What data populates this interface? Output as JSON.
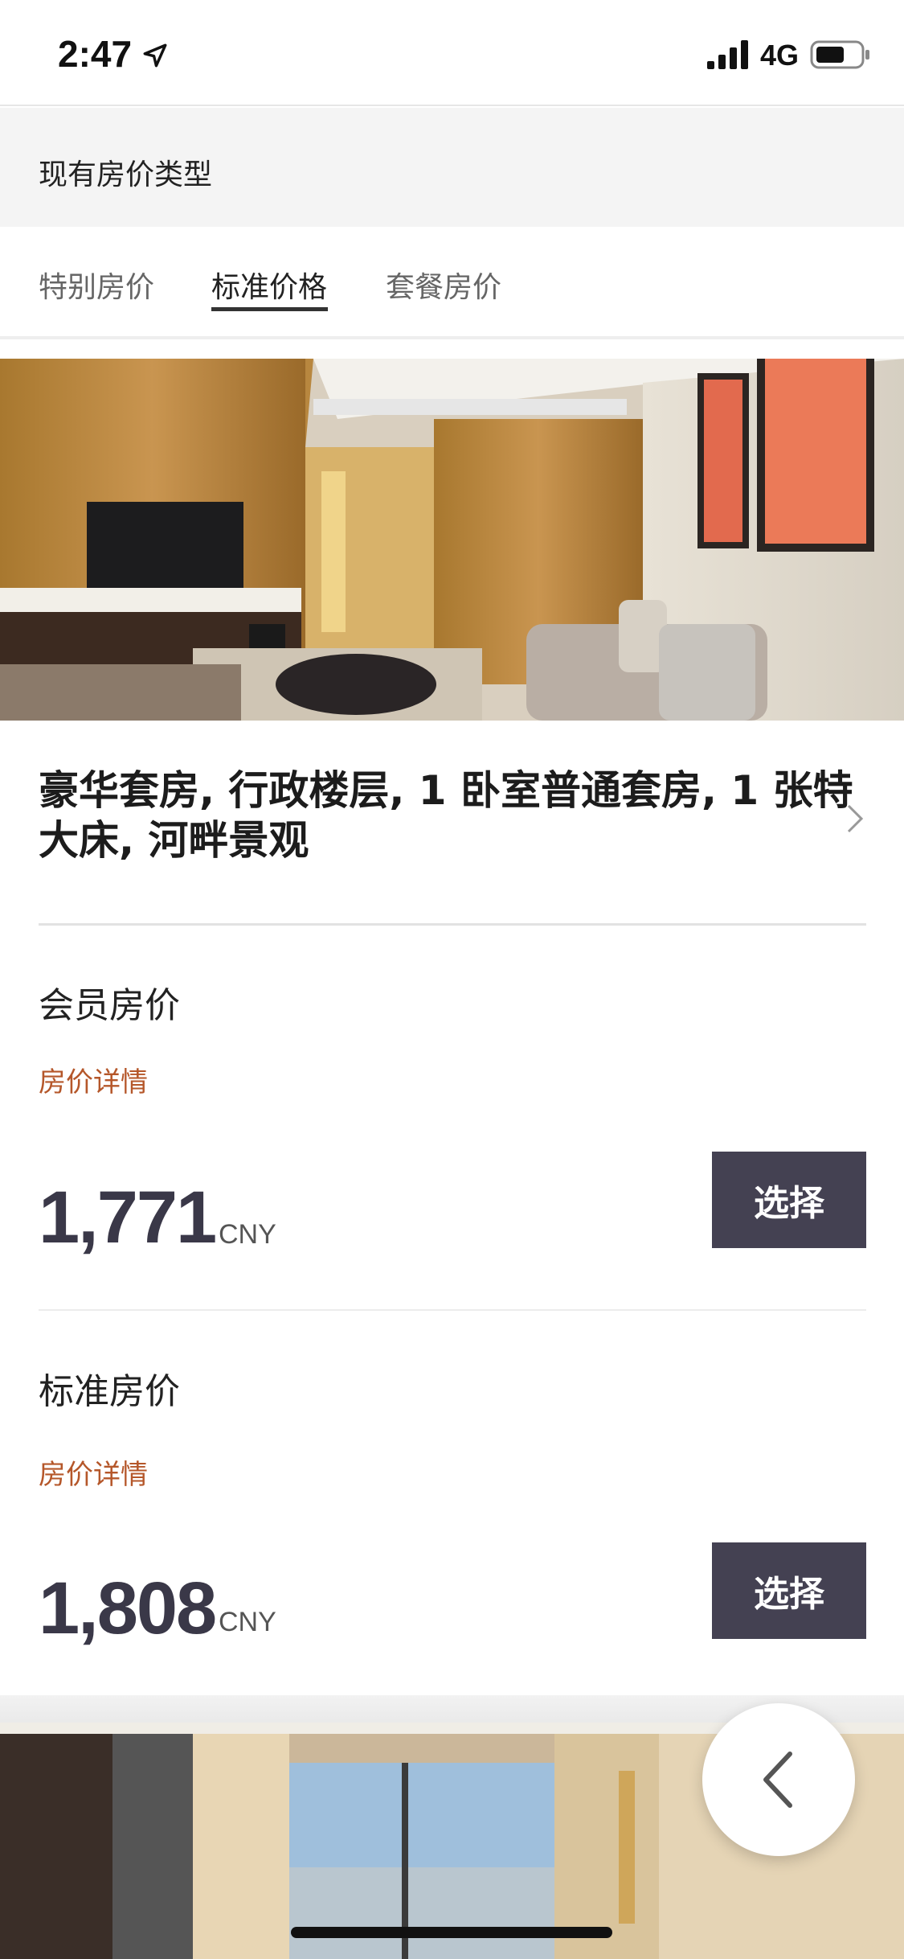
{
  "status_bar": {
    "time": "2:47",
    "network": "4G"
  },
  "section": {
    "title": "现有房价类型"
  },
  "tabs": [
    {
      "label": "特别房价",
      "active": false
    },
    {
      "label": "标准价格",
      "active": true
    },
    {
      "label": "套餐房价",
      "active": false
    }
  ],
  "room": {
    "title": "豪华套房, 行政楼层, 1 卧室普通套房, 1 张特大床, 河畔景观"
  },
  "rates": [
    {
      "name": "会员房价",
      "detail_link": "房价详情",
      "price": "1,771",
      "currency": "CNY",
      "select_label": "选择"
    },
    {
      "name": "标准房价",
      "detail_link": "房价详情",
      "price": "1,808",
      "currency": "CNY",
      "select_label": "选择"
    }
  ],
  "colors": {
    "accent_link": "#b5572a",
    "button_bg": "#444152",
    "price_text": "#3a3848"
  },
  "icons": {
    "location": "location-arrow-icon",
    "signal": "cellular-signal-icon",
    "battery": "battery-icon",
    "chevron": "chevron-right-icon",
    "back": "chevron-left-icon"
  }
}
